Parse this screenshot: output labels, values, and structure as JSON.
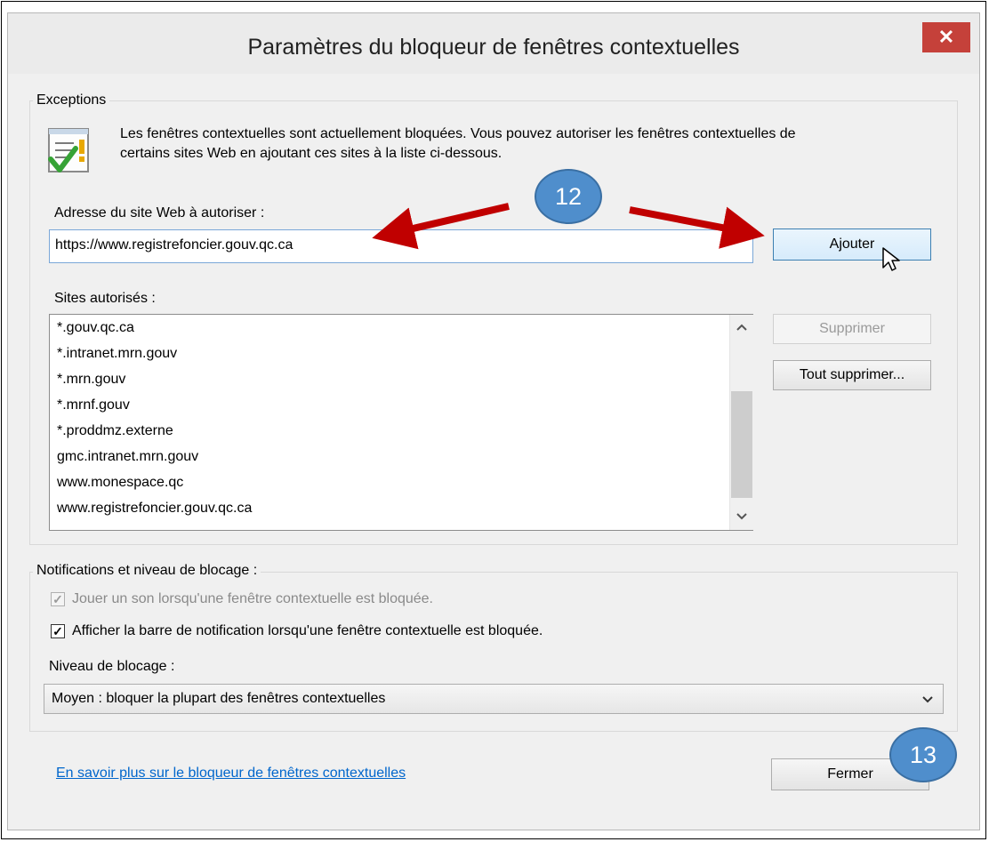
{
  "dialog": {
    "title": "Paramètres du bloqueur de fenêtres contextuelles",
    "close_symbol": "✕"
  },
  "exceptions": {
    "legend": "Exceptions",
    "description_line1": "Les fenêtres contextuelles sont actuellement bloquées.  Vous pouvez autoriser les fenêtres contextuelles de",
    "description_line2": "certains sites Web en ajoutant ces sites à la liste ci-dessous.",
    "address_label": "Adresse du site Web à autoriser :",
    "address_value": "https://www.registrefoncier.gouv.qc.ca",
    "add_button": "Ajouter",
    "allowed_label": "Sites autorisés :",
    "allowed_sites": [
      "*.gouv.qc.ca",
      "*.intranet.mrn.gouv",
      "*.mrn.gouv",
      "*.mrnf.gouv",
      "*.proddmz.externe",
      "gmc.intranet.mrn.gouv",
      "www.monespace.qc",
      "www.registrefoncier.gouv.qc.ca"
    ],
    "remove_button": "Supprimer",
    "remove_all_button": "Tout supprimer..."
  },
  "notifications": {
    "legend": "Notifications et niveau de blocage :",
    "play_sound_label": "Jouer un son lorsqu'une fenêtre contextuelle est bloquée.",
    "play_sound_checked": true,
    "show_bar_label": "Afficher la barre de notification lorsqu'une fenêtre contextuelle est bloquée.",
    "show_bar_checked": true,
    "level_label": "Niveau de blocage :",
    "level_value": "Moyen : bloquer la plupart des fenêtres contextuelles"
  },
  "footer": {
    "learn_more_link": "En savoir plus sur le bloqueur de fenêtres contextuelles",
    "close_button": "Fermer"
  },
  "callouts": {
    "step_a": "12",
    "step_b": "13",
    "color": "#4f8ecc",
    "arrow_color": "#c00000"
  },
  "icons": {
    "exceptions_icon": "notepad-check-icon",
    "close": "close-icon",
    "cursor": "mouse-pointer-icon"
  }
}
